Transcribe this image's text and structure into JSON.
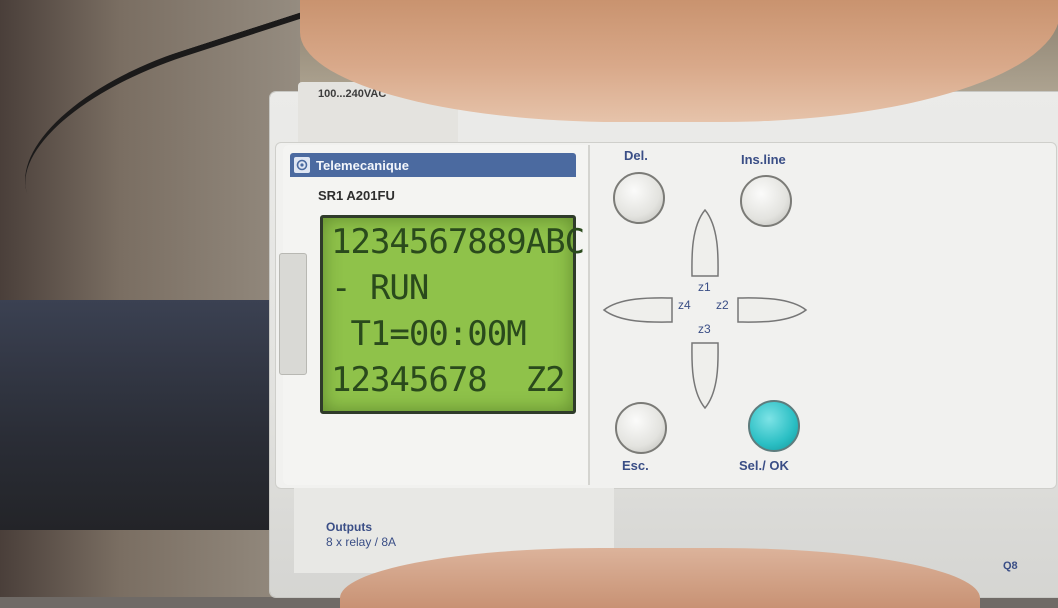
{
  "device": {
    "voltage_label": "100...240VAC",
    "brand": "Telemecanique",
    "model": "SR1 A201FU",
    "lcd_lines": [
      "1234567889ABC",
      "- RUN",
      " T1=00:00M",
      "12345678  Z2"
    ],
    "buttons": {
      "del": "Del.",
      "ins_line": "Ins.line",
      "esc": "Esc.",
      "sel_ok": "Sel./ OK"
    },
    "directions": {
      "z1": "z1",
      "z2": "z2",
      "z3": "z3",
      "z4": "z4"
    },
    "outputs_title": "Outputs",
    "outputs_spec": "8 x relay / 8A",
    "terminal_label": "Q8",
    "colors": {
      "lcd_green": "#8fc24a",
      "brand_blue": "#4b6aa0",
      "ok_cyan": "#2bbfc4"
    }
  }
}
